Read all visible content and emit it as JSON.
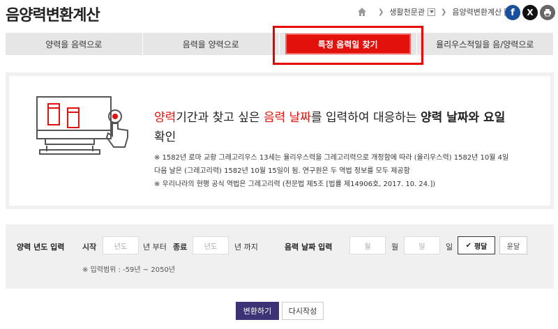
{
  "header": {
    "title": "음양력변환계산",
    "breadcrumb": [
      "생활천문관",
      "음양력변환계산"
    ],
    "share": {
      "facebook": "f",
      "x": "X",
      "print": "print"
    }
  },
  "tabs": [
    {
      "label": "양력을 음력으로"
    },
    {
      "label": "음력을 양력으로"
    },
    {
      "label": "특정 음력일 찾기"
    },
    {
      "label": "율리우스적일을 음/양력으로"
    }
  ],
  "info": {
    "headline_parts": [
      "양력",
      "기간과 찾고 싶은 ",
      "음력 날짜",
      "를 입력하여 대응하는 ",
      "양력 날짜와 요일",
      "확인"
    ],
    "notes": [
      "※ 1582년 로마 교황 그레고리우스 13세는 율리우스력을 그레고리력으로 개정함에 따라 (율리우스력) 1582년 10월 4일",
      "다음 날은 (그레고리력) 1582년 10월 15일이 됨. 연구원은 두 역법 정보를 모두 제공함",
      "※ 우리나라의 현행 공식 역법은 그레고리력 (천문법 제5조 [법률 제14906호, 2017. 10. 24.])"
    ]
  },
  "form": {
    "solar_year_label": "양력 년도 입력",
    "start_label": "시작",
    "start_placeholder": "년도",
    "from_label": "년 부터",
    "end_label": "종료",
    "end_placeholder": "년도",
    "until_label": "년 까지",
    "lunar_date_label": "음력 날짜 입력",
    "month_placeholder": "월",
    "month_label": "월",
    "day_placeholder": "일",
    "day_label": "일",
    "normal_month_label": "평달",
    "leap_month_label": "윤달",
    "range_note": "※ 입력범위 : -59년 ~ 2050년"
  },
  "actions": {
    "convert_label": "변환하기",
    "reset_label": "다시작성"
  },
  "colors": {
    "accent_red": "#e3110c",
    "primary_button": "#3c3276"
  }
}
